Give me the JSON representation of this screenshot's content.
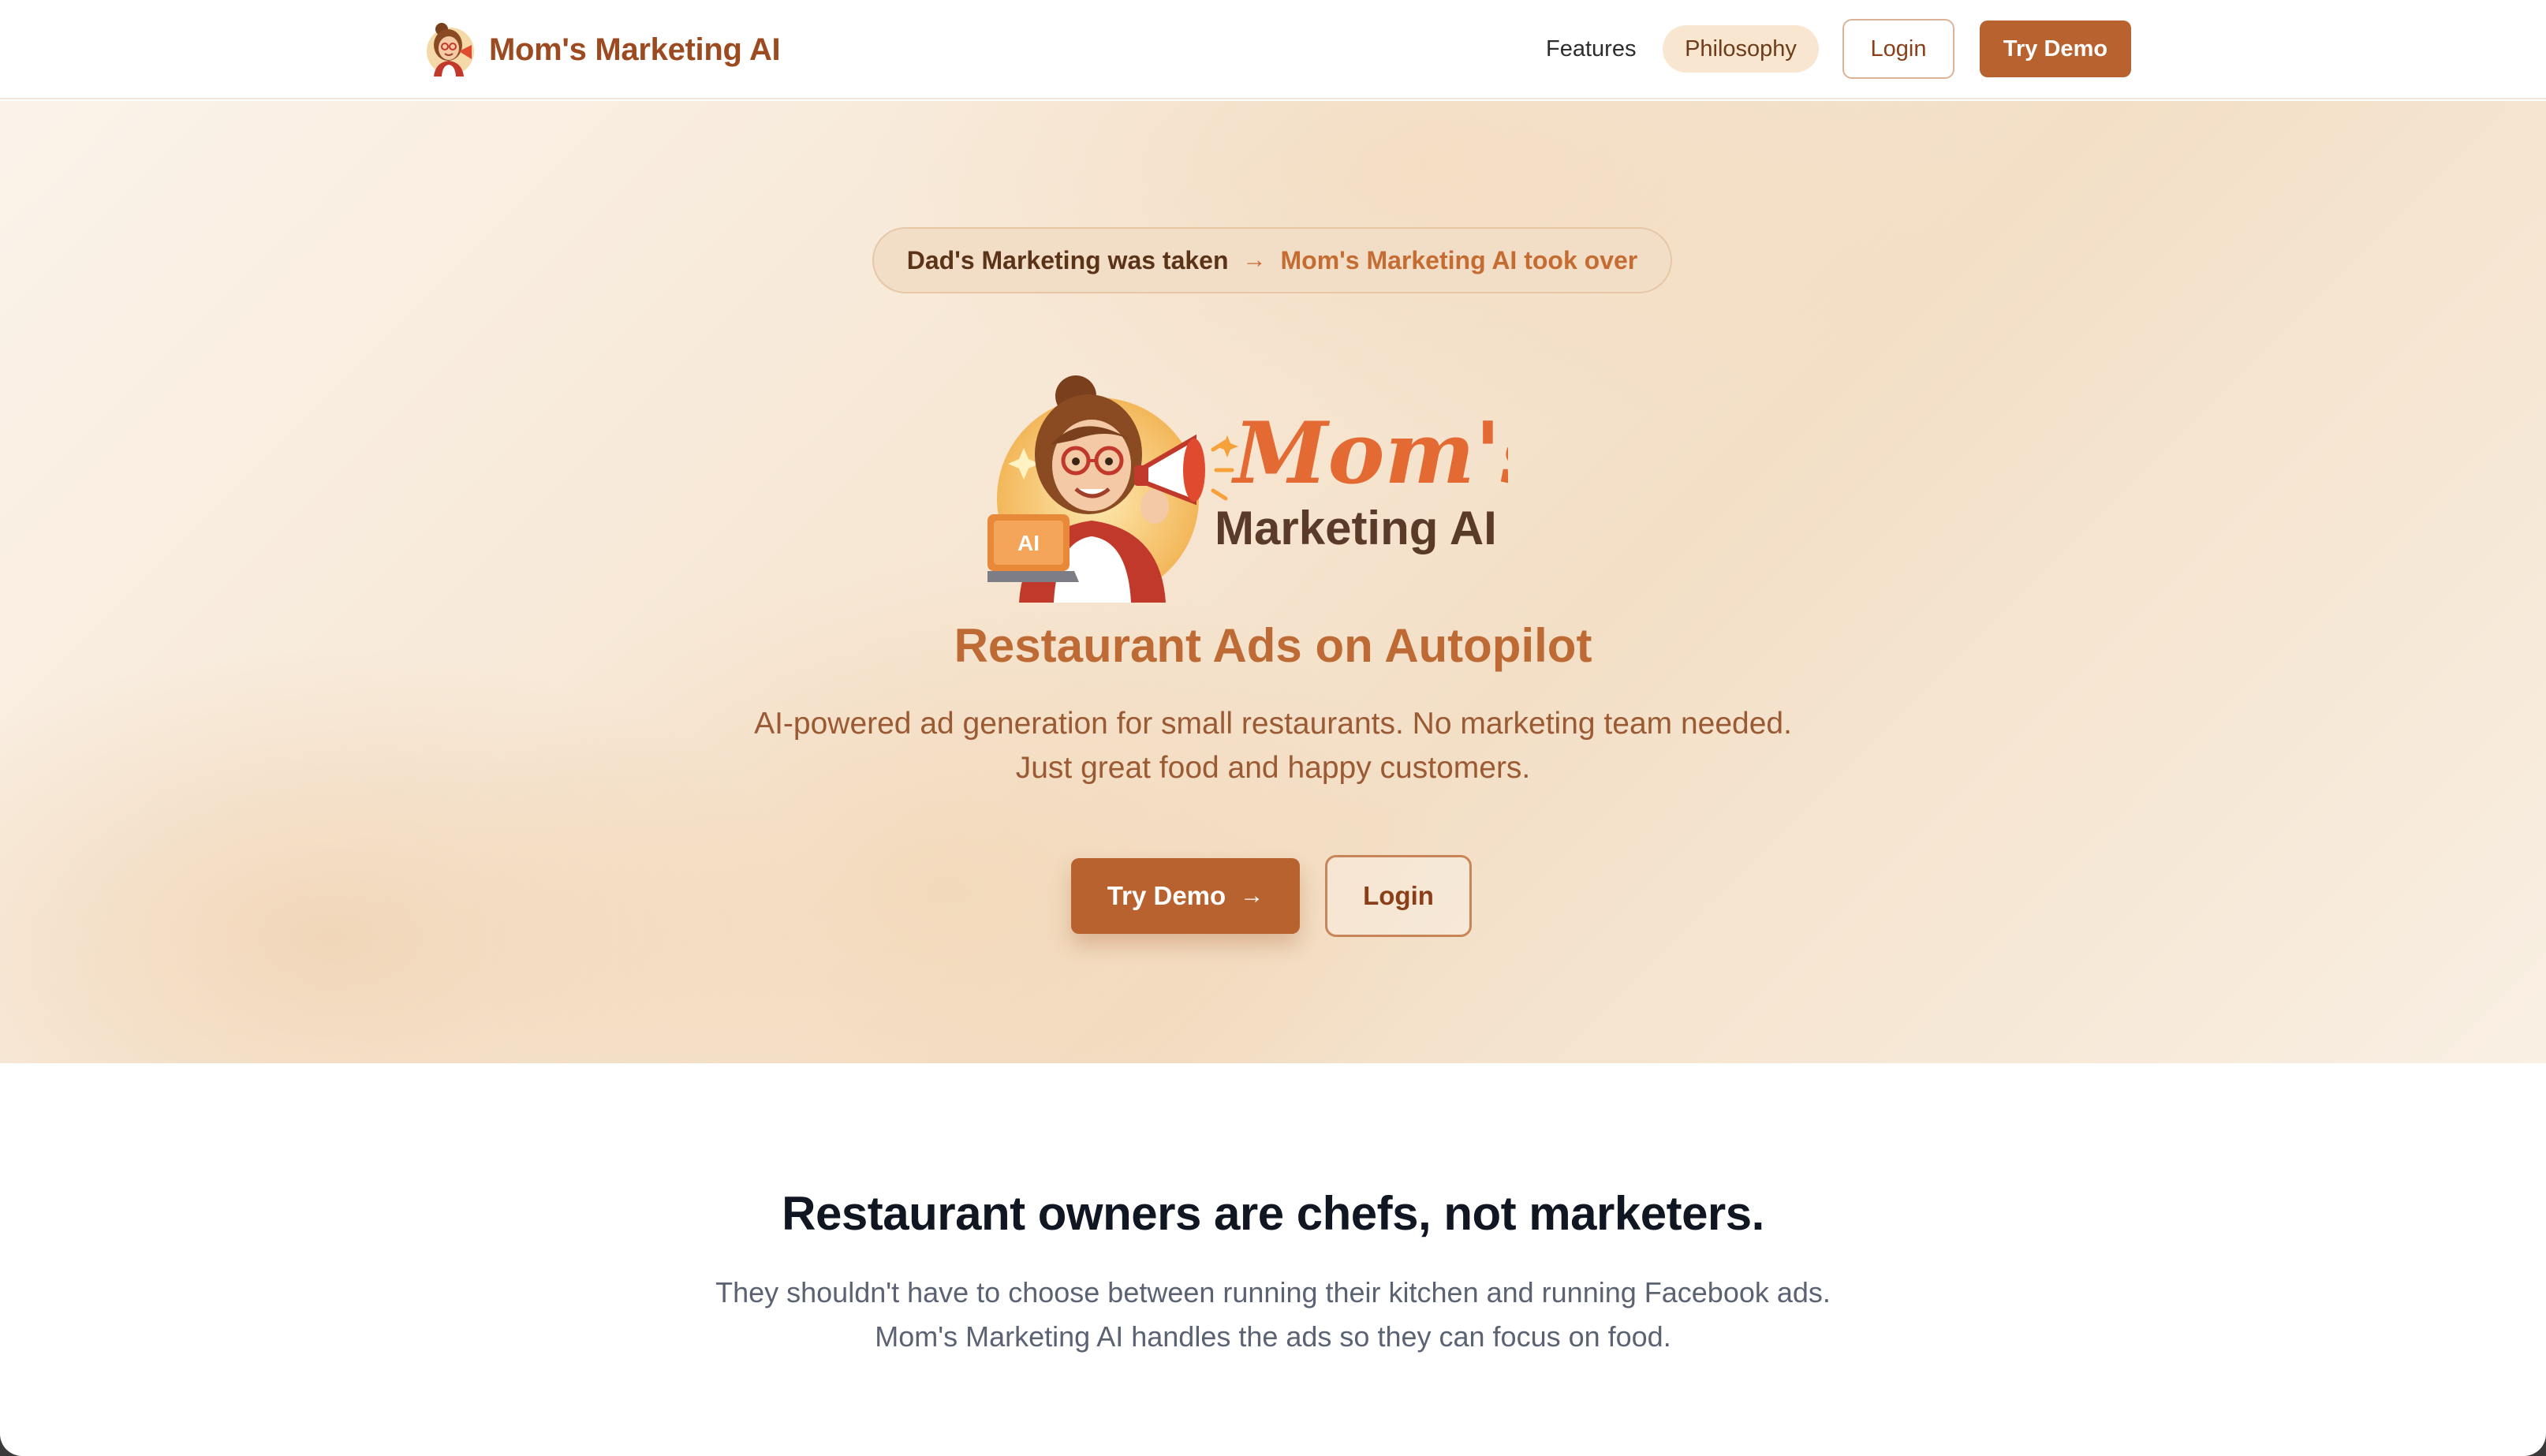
{
  "header": {
    "brand_name": "Mom's Marketing AI",
    "nav": {
      "features": "Features",
      "philosophy": "Philosophy"
    },
    "login_label": "Login",
    "demo_label": "Try Demo"
  },
  "hero": {
    "pill_left": "Dad's Marketing was taken",
    "pill_arrow": "→",
    "pill_right": "Mom's Marketing AI took over",
    "logo_text": {
      "script": "Mom's",
      "line2": "Marketing AI",
      "laptop_badge": "AI"
    },
    "title": "Restaurant Ads on Autopilot",
    "subtitle_line1": "AI-powered ad generation for small restaurants. No marketing team needed.",
    "subtitle_line2": "Just great food and happy customers.",
    "cta_demo": "Try Demo",
    "cta_arrow": "→",
    "cta_login": "Login"
  },
  "philosophy": {
    "title": "Restaurant owners are chefs, not marketers.",
    "body_line1": "They shouldn't have to choose between running their kitchen and running Facebook ads.",
    "body_line2": "Mom's Marketing AI handles the ads so they can focus on food."
  },
  "colors": {
    "brand": "#9c4a20",
    "accent": "#b7622f",
    "hero_title": "#be6a35",
    "heading_dark": "#101622"
  },
  "icons": {
    "brand_logo": "mom-mascot-icon",
    "hero_logo": "mom-mascot-megaphone-logo"
  }
}
